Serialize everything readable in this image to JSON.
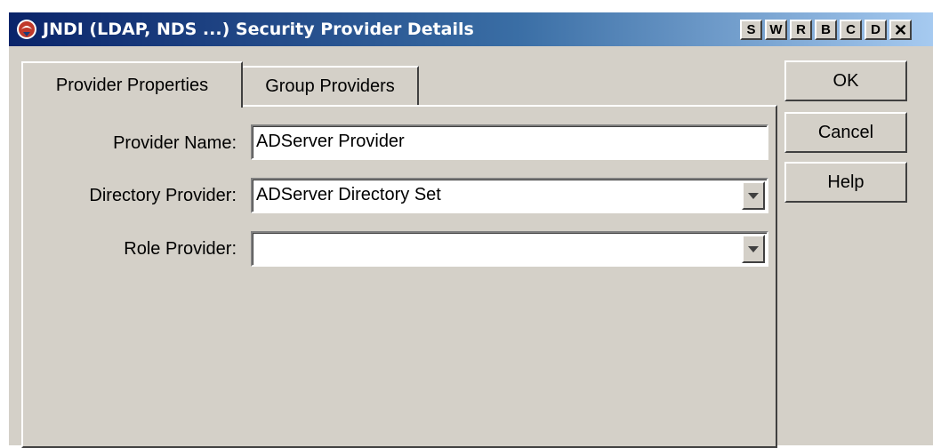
{
  "window": {
    "title": "JNDI (LDAP, NDS ...) Security Provider Details",
    "title_buttons": [
      "S",
      "W",
      "R",
      "B",
      "C",
      "D"
    ],
    "close_label": "✕"
  },
  "tabs": [
    {
      "label": "Provider Properties",
      "active": true
    },
    {
      "label": "Group Providers",
      "active": false
    }
  ],
  "form": {
    "provider_name": {
      "label": "Provider Name:",
      "value": "ADServer Provider"
    },
    "directory_provider": {
      "label": "Directory Provider:",
      "value": "ADServer Directory Set"
    },
    "role_provider": {
      "label": "Role Provider:",
      "value": ""
    }
  },
  "buttons": {
    "ok": "OK",
    "cancel": "Cancel",
    "help": "Help"
  },
  "icons": {
    "title_icon": "app-logo-icon",
    "combo_arrow": "chevron-down-icon"
  },
  "colors": {
    "titlebar_start": "#0a246a",
    "titlebar_end": "#a6caf0",
    "face": "#d4d0c8"
  }
}
